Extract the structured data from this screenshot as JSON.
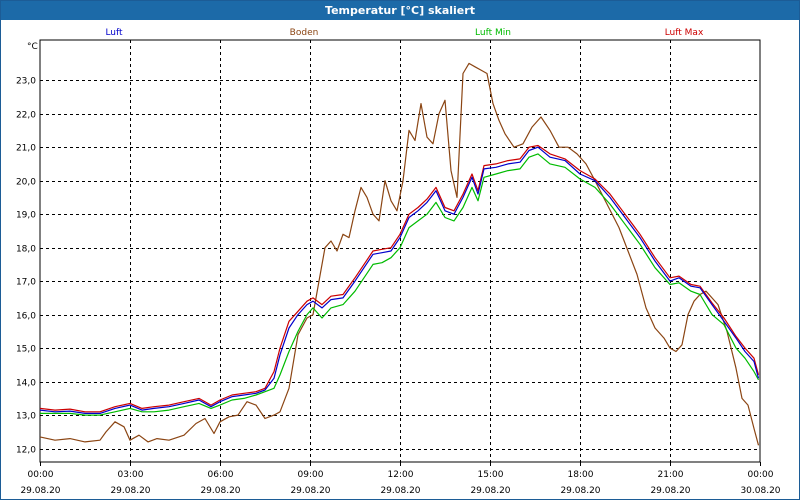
{
  "window": {
    "title": "Temperatur [°C] skaliert"
  },
  "colors": {
    "luft": "#0000cc",
    "boden": "#8b4513",
    "luft_min": "#00bb00",
    "luft_max": "#cc0000",
    "grid": "#000000",
    "titlebar": "#1c6aa8"
  },
  "chart_data": {
    "type": "line",
    "title": "Temperatur [°C] skaliert",
    "ylabel": "°C",
    "xlabel": "",
    "xlim": [
      0,
      24
    ],
    "ylim": [
      11.6,
      24.2
    ],
    "grid": true,
    "legend_position": "top",
    "yticks": [
      12.0,
      13.0,
      14.0,
      15.0,
      16.0,
      17.0,
      18.0,
      19.0,
      20.0,
      21.0,
      22.0,
      23.0
    ],
    "ytick_labels": [
      "12,0",
      "13,0",
      "14,0",
      "15,0",
      "16,0",
      "17,0",
      "18,0",
      "19,0",
      "20,0",
      "21,0",
      "22,0",
      "23,0"
    ],
    "xticks": [
      0,
      3,
      6,
      9,
      12,
      15,
      18,
      21,
      24
    ],
    "xtick_times": [
      "00:00",
      "03:00",
      "06:00",
      "09:00",
      "12:00",
      "15:00",
      "18:00",
      "21:00",
      "00:00"
    ],
    "xtick_dates": [
      "29.08.20",
      "29.08.20",
      "29.08.20",
      "29.08.20",
      "29.08.20",
      "29.08.20",
      "29.08.20",
      "29.08.20",
      "30.08.20"
    ],
    "series": [
      {
        "name": "Luft",
        "color": "#0000cc",
        "points": [
          [
            0,
            13.15
          ],
          [
            0.5,
            13.1
          ],
          [
            1,
            13.12
          ],
          [
            1.5,
            13.05
          ],
          [
            2,
            13.05
          ],
          [
            2.5,
            13.2
          ],
          [
            3,
            13.3
          ],
          [
            3.4,
            13.15
          ],
          [
            3.8,
            13.2
          ],
          [
            4.3,
            13.25
          ],
          [
            4.8,
            13.35
          ],
          [
            5.3,
            13.45
          ],
          [
            5.7,
            13.25
          ],
          [
            6,
            13.4
          ],
          [
            6.4,
            13.55
          ],
          [
            6.8,
            13.6
          ],
          [
            7.2,
            13.65
          ],
          [
            7.5,
            13.75
          ],
          [
            7.8,
            14.1
          ],
          [
            8,
            14.8
          ],
          [
            8.3,
            15.6
          ],
          [
            8.6,
            16.0
          ],
          [
            8.9,
            16.3
          ],
          [
            9.1,
            16.4
          ],
          [
            9.4,
            16.2
          ],
          [
            9.7,
            16.45
          ],
          [
            10.1,
            16.5
          ],
          [
            10.5,
            17.0
          ],
          [
            10.8,
            17.4
          ],
          [
            11.1,
            17.8
          ],
          [
            11.4,
            17.85
          ],
          [
            11.7,
            17.9
          ],
          [
            12,
            18.3
          ],
          [
            12.3,
            18.9
          ],
          [
            12.6,
            19.1
          ],
          [
            12.9,
            19.35
          ],
          [
            13.2,
            19.7
          ],
          [
            13.5,
            19.1
          ],
          [
            13.8,
            19.0
          ],
          [
            14.1,
            19.5
          ],
          [
            14.4,
            20.1
          ],
          [
            14.6,
            19.6
          ],
          [
            14.8,
            20.35
          ],
          [
            15.2,
            20.4
          ],
          [
            15.6,
            20.5
          ],
          [
            16.0,
            20.55
          ],
          [
            16.3,
            20.9
          ],
          [
            16.6,
            21.0
          ],
          [
            17.0,
            20.7
          ],
          [
            17.5,
            20.6
          ],
          [
            18.0,
            20.2
          ],
          [
            18.5,
            20.0
          ],
          [
            19.0,
            19.5
          ],
          [
            19.5,
            18.9
          ],
          [
            20.0,
            18.3
          ],
          [
            20.5,
            17.6
          ],
          [
            21.0,
            17.0
          ],
          [
            21.3,
            17.1
          ],
          [
            21.7,
            16.85
          ],
          [
            22.0,
            16.8
          ],
          [
            22.4,
            16.3
          ],
          [
            22.8,
            15.8
          ],
          [
            23.2,
            15.3
          ],
          [
            23.5,
            14.9
          ],
          [
            23.8,
            14.6
          ],
          [
            23.95,
            14.1
          ]
        ]
      },
      {
        "name": "Boden",
        "color": "#8b4513",
        "points": [
          [
            0,
            12.35
          ],
          [
            0.5,
            12.25
          ],
          [
            1,
            12.3
          ],
          [
            1.5,
            12.2
          ],
          [
            2,
            12.25
          ],
          [
            2.2,
            12.5
          ],
          [
            2.5,
            12.8
          ],
          [
            2.8,
            12.65
          ],
          [
            3.0,
            12.25
          ],
          [
            3.3,
            12.4
          ],
          [
            3.6,
            12.2
          ],
          [
            3.9,
            12.3
          ],
          [
            4.3,
            12.25
          ],
          [
            4.8,
            12.4
          ],
          [
            5.2,
            12.75
          ],
          [
            5.5,
            12.9
          ],
          [
            5.8,
            12.45
          ],
          [
            6.0,
            12.8
          ],
          [
            6.3,
            12.95
          ],
          [
            6.6,
            13.0
          ],
          [
            6.9,
            13.4
          ],
          [
            7.2,
            13.3
          ],
          [
            7.5,
            12.9
          ],
          [
            7.8,
            13.0
          ],
          [
            8.0,
            13.1
          ],
          [
            8.3,
            13.8
          ],
          [
            8.6,
            15.4
          ],
          [
            8.9,
            15.9
          ],
          [
            9.1,
            16.0
          ],
          [
            9.3,
            17.0
          ],
          [
            9.5,
            18.0
          ],
          [
            9.7,
            18.2
          ],
          [
            9.9,
            17.9
          ],
          [
            10.1,
            18.4
          ],
          [
            10.3,
            18.3
          ],
          [
            10.5,
            19.1
          ],
          [
            10.7,
            19.8
          ],
          [
            10.9,
            19.5
          ],
          [
            11.1,
            19.0
          ],
          [
            11.3,
            18.8
          ],
          [
            11.5,
            20.0
          ],
          [
            11.7,
            19.4
          ],
          [
            11.9,
            19.1
          ],
          [
            12.1,
            20.0
          ],
          [
            12.3,
            21.5
          ],
          [
            12.5,
            21.2
          ],
          [
            12.7,
            22.3
          ],
          [
            12.9,
            21.3
          ],
          [
            13.1,
            21.1
          ],
          [
            13.3,
            22.0
          ],
          [
            13.5,
            22.4
          ],
          [
            13.7,
            20.3
          ],
          [
            13.9,
            19.5
          ],
          [
            14.1,
            23.2
          ],
          [
            14.3,
            23.5
          ],
          [
            14.5,
            23.4
          ],
          [
            14.7,
            23.3
          ],
          [
            14.9,
            23.2
          ],
          [
            15.1,
            22.3
          ],
          [
            15.3,
            21.8
          ],
          [
            15.5,
            21.4
          ],
          [
            15.8,
            21.0
          ],
          [
            16.1,
            21.1
          ],
          [
            16.4,
            21.6
          ],
          [
            16.7,
            21.9
          ],
          [
            17.0,
            21.5
          ],
          [
            17.3,
            21.0
          ],
          [
            17.6,
            21.0
          ],
          [
            17.9,
            20.8
          ],
          [
            18.2,
            20.5
          ],
          [
            18.5,
            20.0
          ],
          [
            18.9,
            19.3
          ],
          [
            19.3,
            18.6
          ],
          [
            19.6,
            17.9
          ],
          [
            19.9,
            17.2
          ],
          [
            20.2,
            16.2
          ],
          [
            20.5,
            15.6
          ],
          [
            20.8,
            15.3
          ],
          [
            21.0,
            15.0
          ],
          [
            21.2,
            14.9
          ],
          [
            21.4,
            15.1
          ],
          [
            21.6,
            16.0
          ],
          [
            21.8,
            16.4
          ],
          [
            22.0,
            16.6
          ],
          [
            22.2,
            16.7
          ],
          [
            22.4,
            16.5
          ],
          [
            22.6,
            16.3
          ],
          [
            22.9,
            15.5
          ],
          [
            23.2,
            14.4
          ],
          [
            23.4,
            13.5
          ],
          [
            23.6,
            13.3
          ],
          [
            23.8,
            12.6
          ],
          [
            23.95,
            12.1
          ]
        ]
      },
      {
        "name": "Luft Min",
        "color": "#00bb00",
        "points": [
          [
            0,
            13.05
          ],
          [
            0.5,
            13.05
          ],
          [
            1,
            13.05
          ],
          [
            1.5,
            13.0
          ],
          [
            2,
            13.0
          ],
          [
            2.5,
            13.1
          ],
          [
            3,
            13.2
          ],
          [
            3.4,
            13.1
          ],
          [
            3.8,
            13.1
          ],
          [
            4.3,
            13.15
          ],
          [
            4.8,
            13.25
          ],
          [
            5.3,
            13.35
          ],
          [
            5.7,
            13.2
          ],
          [
            6,
            13.3
          ],
          [
            6.4,
            13.45
          ],
          [
            6.8,
            13.5
          ],
          [
            7.2,
            13.6
          ],
          [
            7.5,
            13.7
          ],
          [
            7.8,
            13.8
          ],
          [
            8.0,
            14.2
          ],
          [
            8.3,
            14.9
          ],
          [
            8.6,
            15.5
          ],
          [
            8.9,
            16.0
          ],
          [
            9.1,
            16.2
          ],
          [
            9.4,
            15.9
          ],
          [
            9.7,
            16.2
          ],
          [
            10.1,
            16.3
          ],
          [
            10.5,
            16.7
          ],
          [
            10.8,
            17.1
          ],
          [
            11.1,
            17.5
          ],
          [
            11.4,
            17.55
          ],
          [
            11.7,
            17.7
          ],
          [
            12,
            18.0
          ],
          [
            12.3,
            18.6
          ],
          [
            12.6,
            18.8
          ],
          [
            12.9,
            19.0
          ],
          [
            13.2,
            19.35
          ],
          [
            13.5,
            18.9
          ],
          [
            13.8,
            18.8
          ],
          [
            14.1,
            19.2
          ],
          [
            14.4,
            19.8
          ],
          [
            14.6,
            19.4
          ],
          [
            14.8,
            20.1
          ],
          [
            15.2,
            20.2
          ],
          [
            15.6,
            20.3
          ],
          [
            16.0,
            20.35
          ],
          [
            16.3,
            20.7
          ],
          [
            16.6,
            20.8
          ],
          [
            17.0,
            20.5
          ],
          [
            17.5,
            20.4
          ],
          [
            18.0,
            20.05
          ],
          [
            18.5,
            19.8
          ],
          [
            19.0,
            19.3
          ],
          [
            19.5,
            18.7
          ],
          [
            20.0,
            18.1
          ],
          [
            20.5,
            17.4
          ],
          [
            21.0,
            16.9
          ],
          [
            21.3,
            16.95
          ],
          [
            21.7,
            16.7
          ],
          [
            22.0,
            16.6
          ],
          [
            22.4,
            16.0
          ],
          [
            22.8,
            15.7
          ],
          [
            23.2,
            15.0
          ],
          [
            23.5,
            14.7
          ],
          [
            23.8,
            14.3
          ],
          [
            23.95,
            14.05
          ]
        ]
      },
      {
        "name": "Luft Max",
        "color": "#cc0000",
        "points": [
          [
            0,
            13.2
          ],
          [
            0.5,
            13.15
          ],
          [
            1,
            13.18
          ],
          [
            1.5,
            13.1
          ],
          [
            2,
            13.1
          ],
          [
            2.5,
            13.25
          ],
          [
            3,
            13.35
          ],
          [
            3.4,
            13.2
          ],
          [
            3.8,
            13.25
          ],
          [
            4.3,
            13.3
          ],
          [
            4.8,
            13.4
          ],
          [
            5.3,
            13.5
          ],
          [
            5.7,
            13.3
          ],
          [
            6,
            13.45
          ],
          [
            6.4,
            13.6
          ],
          [
            6.8,
            13.65
          ],
          [
            7.2,
            13.7
          ],
          [
            7.5,
            13.8
          ],
          [
            7.8,
            14.3
          ],
          [
            8.0,
            15.0
          ],
          [
            8.3,
            15.8
          ],
          [
            8.6,
            16.1
          ],
          [
            8.9,
            16.4
          ],
          [
            9.1,
            16.5
          ],
          [
            9.4,
            16.3
          ],
          [
            9.7,
            16.55
          ],
          [
            10.1,
            16.6
          ],
          [
            10.5,
            17.1
          ],
          [
            10.8,
            17.5
          ],
          [
            11.1,
            17.9
          ],
          [
            11.4,
            17.95
          ],
          [
            11.7,
            18.0
          ],
          [
            12,
            18.4
          ],
          [
            12.3,
            19.0
          ],
          [
            12.6,
            19.2
          ],
          [
            12.9,
            19.45
          ],
          [
            13.2,
            19.8
          ],
          [
            13.5,
            19.2
          ],
          [
            13.8,
            19.1
          ],
          [
            14.1,
            19.6
          ],
          [
            14.4,
            20.2
          ],
          [
            14.6,
            19.7
          ],
          [
            14.8,
            20.45
          ],
          [
            15.2,
            20.5
          ],
          [
            15.6,
            20.6
          ],
          [
            16.0,
            20.65
          ],
          [
            16.3,
            21.0
          ],
          [
            16.6,
            21.05
          ],
          [
            17.0,
            20.8
          ],
          [
            17.5,
            20.65
          ],
          [
            18.0,
            20.3
          ],
          [
            18.5,
            20.05
          ],
          [
            19.0,
            19.6
          ],
          [
            19.5,
            19.0
          ],
          [
            20.0,
            18.4
          ],
          [
            20.5,
            17.7
          ],
          [
            21.0,
            17.1
          ],
          [
            21.3,
            17.15
          ],
          [
            21.7,
            16.9
          ],
          [
            22.0,
            16.85
          ],
          [
            22.4,
            16.35
          ],
          [
            22.8,
            15.9
          ],
          [
            23.2,
            15.35
          ],
          [
            23.5,
            15.0
          ],
          [
            23.8,
            14.7
          ],
          [
            23.95,
            14.2
          ]
        ]
      }
    ]
  }
}
